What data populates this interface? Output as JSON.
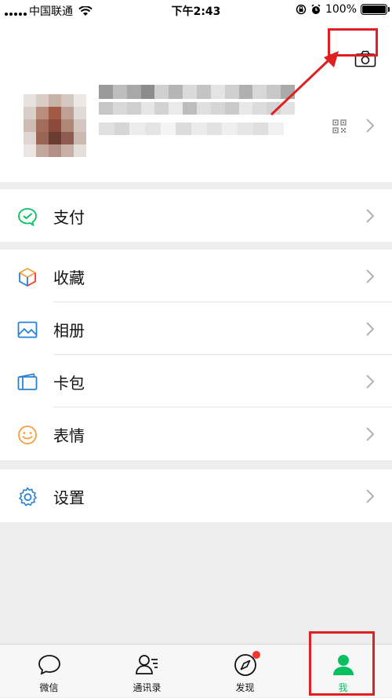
{
  "status_bar": {
    "carrier": "中国联通",
    "time": "下午2:43",
    "battery_percent": "100%",
    "battery_level": 1.0
  },
  "profile": {
    "camera_icon": "camera-icon",
    "qr_icon": "qr-code-icon"
  },
  "menu": {
    "groups": [
      [
        {
          "label": "支付",
          "icon": "pay-icon",
          "color": "#07c160"
        }
      ],
      [
        {
          "label": "收藏",
          "icon": "favorites-cube-icon",
          "color": "#fa9d3b"
        },
        {
          "label": "相册",
          "icon": "album-icon",
          "color": "#2782d7"
        },
        {
          "label": "卡包",
          "icon": "card-wallet-icon",
          "color": "#2782d7"
        },
        {
          "label": "表情",
          "icon": "emoji-icon",
          "color": "#fa9d3b"
        }
      ],
      [
        {
          "label": "设置",
          "icon": "settings-gear-icon",
          "color": "#2782d7"
        }
      ]
    ]
  },
  "tabbar": {
    "tabs": [
      {
        "label": "微信",
        "icon": "chat-bubble-icon",
        "active": false
      },
      {
        "label": "通讯录",
        "icon": "contacts-icon",
        "active": false
      },
      {
        "label": "发现",
        "icon": "compass-icon",
        "active": false,
        "badge": true
      },
      {
        "label": "我",
        "icon": "person-icon",
        "active": true
      }
    ]
  },
  "colors": {
    "accent": "#07c160",
    "highlight": "#e02020",
    "badge": "#f43530"
  }
}
